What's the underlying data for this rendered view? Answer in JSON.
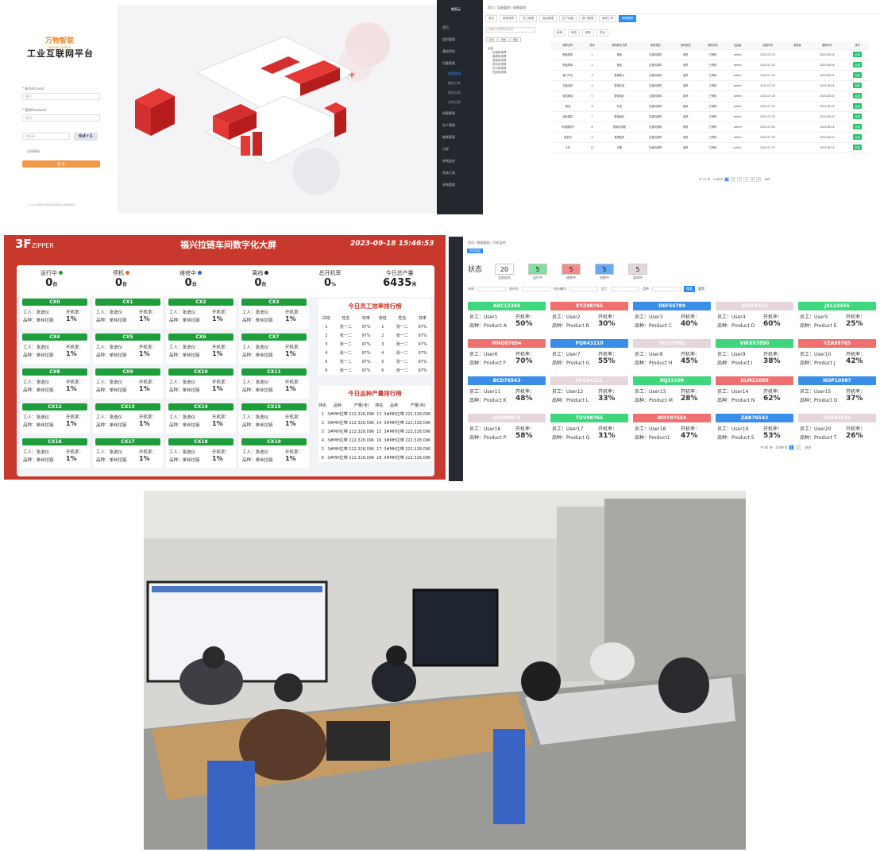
{
  "login": {
    "logo": "万物智联",
    "logo_sub": "wanwu zhilian",
    "title": "工业互联网平台",
    "account_label": "* 账号Account",
    "account_placeholder": "账号",
    "password_label": "* 密码Password",
    "password_placeholder": "密码",
    "captcha_placeholder": "验证码",
    "captcha_text": "6d+1",
    "remember": "记住密码",
    "login_button": "登 录",
    "footer": "© 2023 福建万物智联科技有限公司版权所有"
  },
  "admin": {
    "logo": "数智云",
    "breadcrumb": "首页 / 设备管理 / 故障管理",
    "tabs": [
      "首页",
      "维修故障",
      "员工管理",
      "用品管理",
      "生产线路",
      "部门管理",
      "维修工单",
      "故障管理"
    ],
    "active_tab": 7,
    "side_items": [
      {
        "label": "首页",
        "sub": false,
        "act": false
      },
      {
        "label": "组织管理",
        "sub": false,
        "act": false
      },
      {
        "label": "基础资料",
        "sub": false,
        "act": false
      },
      {
        "label": "设备管理",
        "sub": false,
        "act": false
      },
      {
        "label": "故障管理",
        "sub": true,
        "act": true
      },
      {
        "label": "维修工单",
        "sub": true,
        "act": false
      },
      {
        "label": "保养记录",
        "sub": true,
        "act": false
      },
      {
        "label": "点检记录",
        "sub": true,
        "act": false
      },
      {
        "label": "质量管理",
        "sub": false,
        "act": false
      },
      {
        "label": "生产管理",
        "sub": false,
        "act": false
      },
      {
        "label": "能耗管理",
        "sub": false,
        "act": false
      },
      {
        "label": "大屏",
        "sub": false,
        "act": false
      },
      {
        "label": "系统监控",
        "sub": false,
        "act": false
      },
      {
        "label": "系统工具",
        "sub": false,
        "act": false
      },
      {
        "label": "系统管理",
        "sub": false,
        "act": false
      }
    ],
    "tree_search": "请输入故障类型名称",
    "tree_buttons": [
      "新增",
      "修改",
      "删除"
    ],
    "tree_nodes": [
      "全部",
      "拉链机故障",
      "裁剪机故障",
      "成型机故障",
      "穿头机故障",
      "开口机故障",
      "压胶机故障"
    ],
    "top_buttons": [
      "新增",
      "修改",
      "删除",
      "导出"
    ],
    "filter_labels": [
      "故障描述",
      "故障状态",
      "设备编号"
    ],
    "search_button": "搜索",
    "reset_button": "重置",
    "columns": [
      "故障名称",
      "排序",
      "故障解决方案",
      "故障类型",
      "维修类型",
      "故障状态",
      "创建者",
      "创建时间",
      "更新者",
      "更新时间",
      "操作"
    ],
    "rows": [
      [
        "断链故障",
        "1",
        "换链",
        "拉链机故障",
        "维修",
        "已审核",
        "admin",
        "2023-07-25",
        "",
        "2023-08-04",
        "启用"
      ],
      [
        "断齿故障",
        "2",
        "换齿",
        "拉链机故障",
        "维修",
        "已审核",
        "admin",
        "2023-07-25",
        "",
        "2023-08-04",
        "启用"
      ],
      [
        "裁刀不切",
        "3",
        "更换裁刀",
        "拉链机故障",
        "维修",
        "已审核",
        "admin",
        "2023-07-25",
        "",
        "2023-08-04",
        "启用"
      ],
      [
        "拉链变形",
        "4",
        "更换拉链",
        "拉链机故障",
        "维修",
        "已审核",
        "admin",
        "2023-07-25",
        "",
        "2023-08-04",
        "启用"
      ],
      [
        "电机故障",
        "5",
        "更换电机",
        "拉链机故障",
        "维修",
        "已审核",
        "admin",
        "2023-07-25",
        "",
        "2023-08-04",
        "启用"
      ],
      [
        "漏油",
        "6",
        "补油",
        "拉链机故障",
        "维修",
        "已审核",
        "admin",
        "2023-07-25",
        "",
        "2023-08-04",
        "启用"
      ],
      [
        "齿轮磨损",
        "7",
        "更换齿轮",
        "拉链机故障",
        "维修",
        "已审核",
        "admin",
        "2023-07-25",
        "",
        "2023-08-04",
        "启用"
      ],
      [
        "传感器损坏",
        "8",
        "更换传感器",
        "拉链机故障",
        "维修",
        "已审核",
        "admin",
        "2023-07-25",
        "",
        "2023-08-04",
        "启用"
      ],
      [
        "链条松",
        "9",
        "更换链条",
        "拉链机故障",
        "维修",
        "已审核",
        "admin",
        "2023-07-25",
        "",
        "2023-08-04",
        "启用"
      ],
      [
        "卡料",
        "10",
        "清理",
        "拉链机故障",
        "维修",
        "已审核",
        "admin",
        "2023-07-25",
        "",
        "2023-08-04",
        "启用"
      ]
    ],
    "pager_total": "共 10 条",
    "pager_size": "10条/页",
    "pager_pages": [
      "1",
      "2",
      "3",
      "4",
      "5",
      "6"
    ],
    "pager_goto": "前往"
  },
  "dashboard": {
    "logo": "3F",
    "logo_sub": "ZIPPER",
    "title": "福兴拉链车间数字化大屏",
    "time": "2023-09-18 15:46:53",
    "stats": [
      {
        "label": "运行中",
        "value": "0",
        "unit": "台",
        "dot": "#1e9e3b"
      },
      {
        "label": "停机",
        "value": "0",
        "unit": "台",
        "dot": "#e8692d"
      },
      {
        "label": "维修中",
        "value": "0",
        "unit": "台",
        "dot": "#3a5bd9"
      },
      {
        "label": "离线",
        "value": "0",
        "unit": "台",
        "dot": "#1f2d4a"
      },
      {
        "label": "总开机率",
        "value": "0",
        "unit": "%",
        "dot": ""
      },
      {
        "label": "今日总产量",
        "value": "6435",
        "unit": "米",
        "dot": ""
      }
    ],
    "lines": [
      "CX0",
      "CX1",
      "CX2",
      "CX3",
      "CX4",
      "CX5",
      "CX6",
      "CX7",
      "CX8",
      "CX9",
      "CX10",
      "CX11",
      "CX12",
      "CX13",
      "CX14",
      "CX15",
      "CX16",
      "CX17",
      "CX18",
      "CX19"
    ],
    "line_worker": "工人：张选仪",
    "line_product": "品种：单丝拉链",
    "line_rate_label": "开机率：",
    "line_rate": "1%",
    "rank1_title": "今日员工效率排行榜",
    "rank1_cols": [
      "白班",
      "姓名",
      "效率",
      "夜班",
      "姓名",
      "效率"
    ],
    "rank1_rows": [
      [
        "1",
        "张一二",
        "97%",
        "1",
        "张一二",
        "97%"
      ],
      [
        "2",
        "张一二",
        "97%",
        "2",
        "张一二",
        "97%"
      ],
      [
        "3",
        "张一二",
        "97%",
        "3",
        "张一二",
        "97%"
      ],
      [
        "4",
        "张一二",
        "97%",
        "4",
        "张一二",
        "97%"
      ],
      [
        "5",
        "张一二",
        "97%",
        "5",
        "张一二",
        "97%"
      ],
      [
        "6",
        "张一二",
        "97%",
        "6",
        "张一二",
        "97%"
      ]
    ],
    "rank2_title": "今日品种产量排行榜",
    "rank2_cols": [
      "排名",
      "品种",
      "产量(米)",
      "排名",
      "品种",
      "产量(米)"
    ],
    "rank2_rows": [
      [
        "1",
        "3#MH拉带",
        "222,328,096",
        "13",
        "3#MH拉带",
        "222,328,096"
      ],
      [
        "2",
        "3#MH拉带",
        "222,328,096",
        "14",
        "3#MH拉带",
        "222,328,096"
      ],
      [
        "3",
        "3#MH拉带",
        "222,328,096",
        "15",
        "3#MH拉带",
        "222,328,096"
      ],
      [
        "4",
        "3#MH拉带",
        "222,328,096",
        "16",
        "3#MH拉带",
        "222,328,096"
      ],
      [
        "5",
        "3#MH拉带",
        "222,328,096",
        "17",
        "3#MH拉带",
        "222,328,096"
      ],
      [
        "6",
        "3#MH拉带",
        "222,328,096",
        "18",
        "3#MH拉带",
        "222,328,096"
      ]
    ]
  },
  "monitor": {
    "breadcrumb": "首页 / 数据看板 / 开机监控",
    "tab": "开机监控",
    "status_label": "状态",
    "boxes": [
      {
        "value": "20",
        "label": "全部机台",
        "color": "#ffffff"
      },
      {
        "value": "5",
        "label": "运行中",
        "color": "#7fe0a0"
      },
      {
        "value": "5",
        "label": "维修中",
        "color": "#f28b8b"
      },
      {
        "value": "5",
        "label": "机修中",
        "color": "#6aa8f0"
      },
      {
        "value": "5",
        "label": "离线中",
        "color": "#e3d8dc"
      }
    ],
    "filters": [
      "车间",
      "机台号",
      "机台编号",
      "员工",
      "品种"
    ],
    "search_button": "搜索",
    "reset_button": "重置",
    "staff_label": "员工：",
    "product_label": "品种：",
    "rate_label": "开机率：",
    "cards": [
      {
        "id": "ABC12345",
        "user": "User1",
        "product": "Product A",
        "rate": "50%",
        "color": "#3fd67e"
      },
      {
        "id": "XYZ98765",
        "user": "User2",
        "product": "Product B",
        "rate": "30%",
        "color": "#f07070"
      },
      {
        "id": "DEF56789",
        "user": "User3",
        "product": "Product C",
        "rate": "40%",
        "color": "#3a8ee8"
      },
      {
        "id": "GHI54321",
        "user": "User4",
        "product": "Product D",
        "rate": "60%",
        "color": "#e4d6da"
      },
      {
        "id": "JKL23456",
        "user": "User5",
        "product": "Product E",
        "rate": "25%",
        "color": "#3fd67e"
      },
      {
        "id": "MNO87654",
        "user": "User6",
        "product": "Product F",
        "rate": "70%",
        "color": "#f07070"
      },
      {
        "id": "PQR43210",
        "user": "User7",
        "product": "Product G",
        "rate": "55%",
        "color": "#3a8ee8"
      },
      {
        "id": "STU78901",
        "user": "User8",
        "product": "Product H",
        "rate": "45%",
        "color": "#e4d6da"
      },
      {
        "id": "VWX67890",
        "user": "User9",
        "product": "Product I",
        "rate": "38%",
        "color": "#3fd67e"
      },
      {
        "id": "YZA98765",
        "user": "User10",
        "product": "Product J",
        "rate": "42%",
        "color": "#f07070"
      },
      {
        "id": "BCD76543",
        "user": "User11",
        "product": "Product K",
        "rate": "48%",
        "color": "#3a8ee8"
      },
      {
        "id": "EFG54321",
        "user": "User12",
        "product": "Product L",
        "rate": "33%",
        "color": "#e4d6da"
      },
      {
        "id": "HIJ32109",
        "user": "User13",
        "product": "Product M",
        "rate": "28%",
        "color": "#3fd67e"
      },
      {
        "id": "KLM21098",
        "user": "User14",
        "product": "Product N",
        "rate": "62%",
        "color": "#f07070"
      },
      {
        "id": "NOP10987",
        "user": "User15",
        "product": "Product O",
        "rate": "37%",
        "color": "#3a8ee8"
      },
      {
        "id": "QRS09876",
        "user": "User16",
        "product": "Product P",
        "rate": "58%",
        "color": "#e4d6da"
      },
      {
        "id": "TUV98765",
        "user": "User17",
        "product": "Product Q",
        "rate": "31%",
        "color": "#3fd67e"
      },
      {
        "id": "WXY87654",
        "user": "User18",
        "product": "Product1",
        "rate": "47%",
        "color": "#f07070"
      },
      {
        "id": "ZAB76543",
        "user": "User19",
        "product": "Product S",
        "rate": "53%",
        "color": "#3a8ee8"
      },
      {
        "id": "CDE65432",
        "user": "User20",
        "product": "Product T",
        "rate": "26%",
        "color": "#e4d6da"
      }
    ],
    "pager_total": "共 40 条",
    "pager_size": "20条/页",
    "pager_pages": [
      "1",
      "2"
    ],
    "pager_goto": "前往"
  }
}
